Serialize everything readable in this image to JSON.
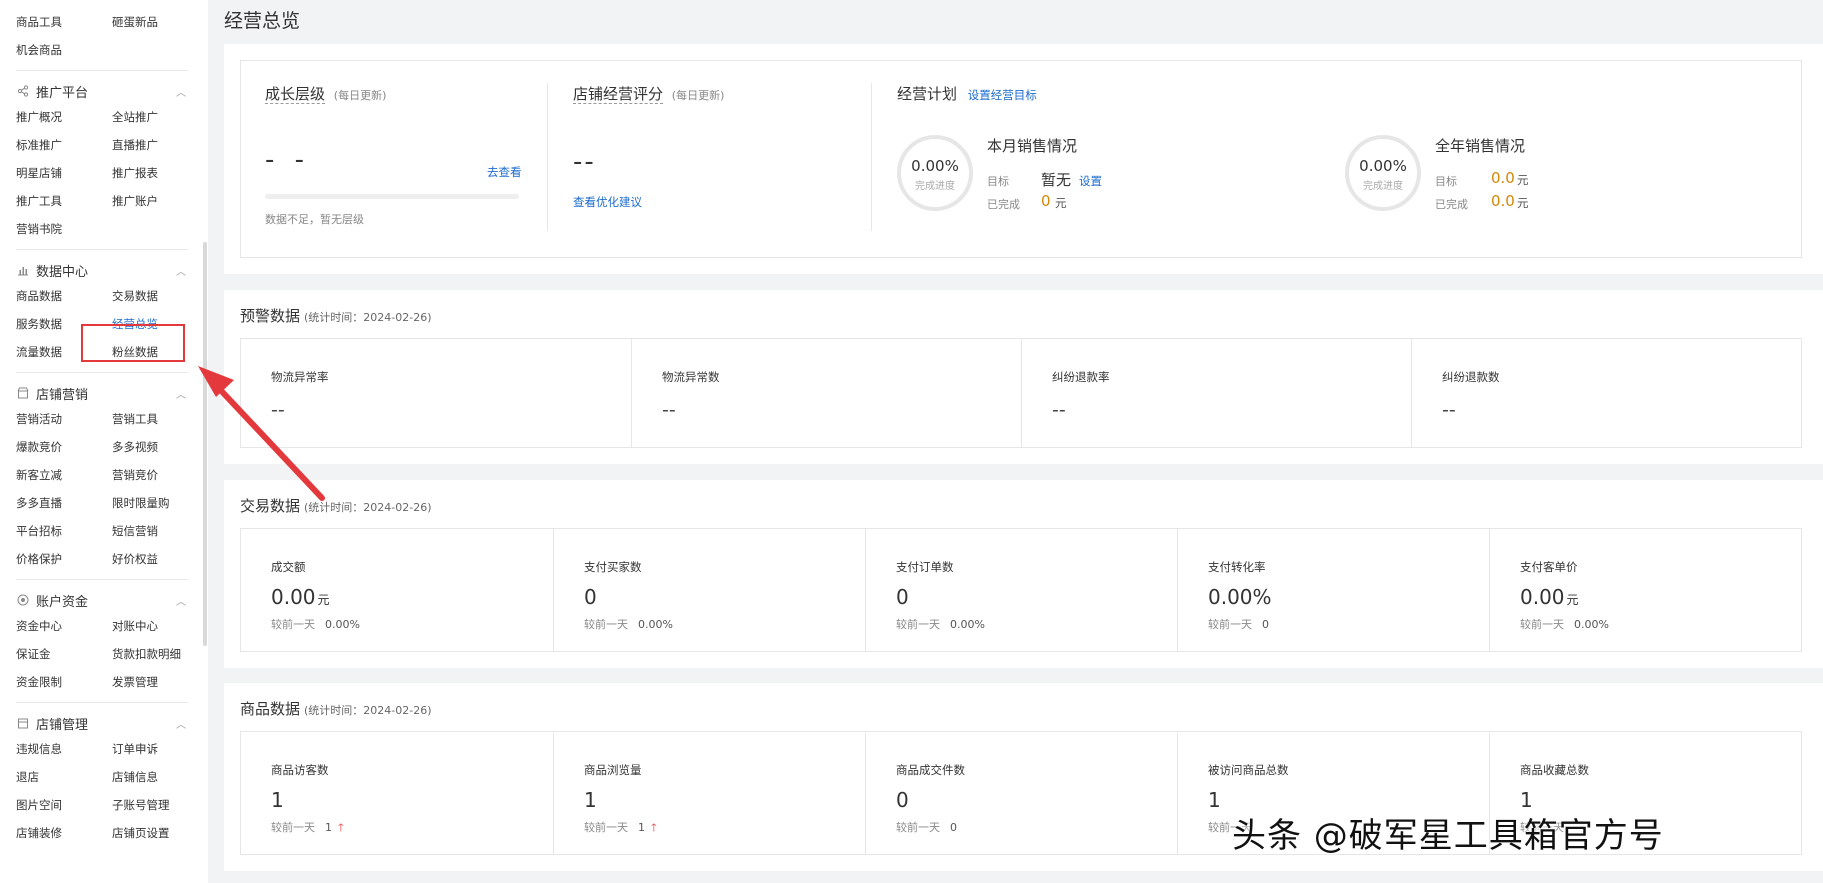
{
  "sidebar": {
    "top_items": [
      "商品工具",
      "砸蛋新品",
      "机会商品"
    ],
    "groups": [
      {
        "title": "推广平台",
        "icon": "share-icon",
        "items": [
          "推广概况",
          "全站推广",
          "标准推广",
          "直播推广",
          "明星店铺",
          "推广报表",
          "推广工具",
          "推广账户",
          "营销书院"
        ]
      },
      {
        "title": "数据中心",
        "icon": "bar-chart-icon",
        "items": [
          "商品数据",
          "交易数据",
          "服务数据",
          "经营总览",
          "流量数据",
          "粉丝数据"
        ]
      },
      {
        "title": "店铺营销",
        "icon": "shop-icon",
        "items": [
          "营销活动",
          "营销工具",
          "爆款竞价",
          "多多视频",
          "新客立减",
          "营销竞价",
          "多多直播",
          "限时限量购",
          "平台招标",
          "短信营销",
          "价格保护",
          "好价权益"
        ]
      },
      {
        "title": "账户资金",
        "icon": "coin-icon",
        "items": [
          "资金中心",
          "对账中心",
          "保证金",
          "货款扣款明细",
          "资金限制",
          "发票管理"
        ]
      },
      {
        "title": "店铺管理",
        "icon": "store-icon",
        "items": [
          "违规信息",
          "订单申诉",
          "退店",
          "店铺信息",
          "图片空间",
          "子账号管理",
          "店铺装修",
          "店铺页设置"
        ]
      }
    ]
  },
  "page": {
    "title": "经营总览"
  },
  "overview": {
    "growth": {
      "title": "成长层级",
      "note": "(每日更新)",
      "value": "- -",
      "link": "去查看",
      "desc": "数据不足，暂无层级"
    },
    "score": {
      "title": "店铺经营评分",
      "note": "(每日更新)",
      "value": "--",
      "link": "查看优化建议"
    },
    "plan": {
      "title": "经营计划",
      "link": "设置经营目标",
      "month": {
        "title": "本月销售情况",
        "pct": "0.00%",
        "cap": "完成进度",
        "target_label": "目标",
        "target_value": "暂无",
        "target_link": "设置",
        "done_label": "已完成",
        "done_value": "0",
        "unit": "元"
      },
      "year": {
        "title": "全年销售情况",
        "pct": "0.00%",
        "cap": "完成进度",
        "target_label": "目标",
        "target_value": "0.0",
        "done_label": "已完成",
        "done_value": "0.0",
        "unit": "元"
      }
    }
  },
  "warning": {
    "title": "预警数据",
    "sub": "(统计时间：2024-02-26)",
    "cells": [
      {
        "label": "物流异常率",
        "value": "--"
      },
      {
        "label": "物流异常数",
        "value": "--"
      },
      {
        "label": "纠纷退款率",
        "value": "--"
      },
      {
        "label": "纠纷退款数",
        "value": "--"
      }
    ]
  },
  "trade": {
    "title": "交易数据",
    "sub": "(统计时间：2024-02-26)",
    "cmp_label": "较前一天",
    "cells": [
      {
        "label": "成交额",
        "value": "0.00",
        "unit": "元",
        "cmp": "0.00%"
      },
      {
        "label": "支付买家数",
        "value": "0",
        "unit": "",
        "cmp": "0.00%"
      },
      {
        "label": "支付订单数",
        "value": "0",
        "unit": "",
        "cmp": "0.00%"
      },
      {
        "label": "支付转化率",
        "value": "0.00%",
        "unit": "",
        "cmp": "0"
      },
      {
        "label": "支付客单价",
        "value": "0.00",
        "unit": "元",
        "cmp": "0.00%"
      }
    ]
  },
  "goods": {
    "title": "商品数据",
    "sub": "(统计时间：2024-02-26)",
    "cmp_label": "较前一天",
    "cells": [
      {
        "label": "商品访客数",
        "value": "1",
        "cmp": "1",
        "up": true
      },
      {
        "label": "商品浏览量",
        "value": "1",
        "cmp": "1",
        "up": true
      },
      {
        "label": "商品成交件数",
        "value": "0",
        "cmp": "0",
        "up": false
      },
      {
        "label": "被访问商品总数",
        "value": "1",
        "cmp": "",
        "up": false
      },
      {
        "label": "商品收藏总数",
        "value": "1",
        "cmp": "",
        "up": false
      }
    ]
  },
  "watermark": "头条 @破军星工具箱官方号",
  "colors": {
    "accent": "#1c6ccf",
    "highlight": "#e4393c",
    "orange": "#d48806"
  }
}
